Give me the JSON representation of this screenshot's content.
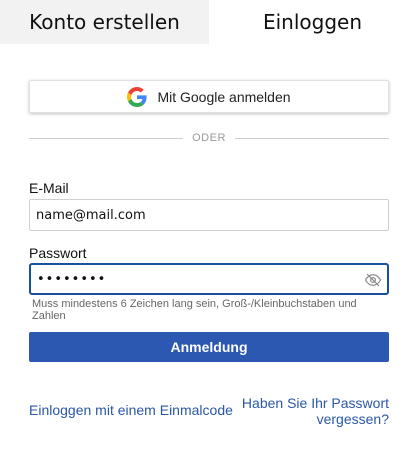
{
  "tabs": {
    "signup_label": "Konto erstellen",
    "login_label": "Einloggen"
  },
  "google": {
    "label": "Mit Google anmelden",
    "icon": "google-g-icon"
  },
  "divider": {
    "label": "ODER"
  },
  "email": {
    "label": "E-Mail",
    "value": "name@mail.com"
  },
  "password": {
    "label": "Passwort",
    "value": "••••••••",
    "toggle_icon": "eye-slash-icon",
    "hint": "Muss mindestens 6 Zeichen lang sein, Groß-/Kleinbuchstaben und Zahlen"
  },
  "submit": {
    "label": "Anmeldung"
  },
  "links": {
    "one_time_code": "Einloggen mit einem Einmalcode",
    "forgot_line1": "Haben Sie Ihr Passwort",
    "forgot_line2": "vergessen?"
  },
  "colors": {
    "primary": "#2d58b2",
    "link": "#2a57a8",
    "focus_border": "#1a4fa0"
  }
}
